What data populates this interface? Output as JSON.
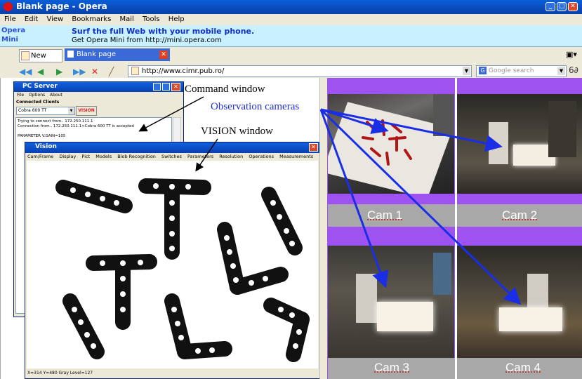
{
  "browser": {
    "title": "Blank page - Opera",
    "menu": [
      "File",
      "Edit",
      "View",
      "Bookmarks",
      "Mail",
      "Tools",
      "Help"
    ],
    "banner": {
      "brand1": "Opera",
      "brand2": "Mini",
      "line1": "Surf the full Web with your mobile phone.",
      "line2": "Get Opera Mini from http://mini.opera.com"
    },
    "tabs": {
      "new_page": "New page",
      "active": "Blank page"
    },
    "address": "http://www.cimr.pub.ro/",
    "search_placeholder": "Google search"
  },
  "pc_server": {
    "title": "PC Server",
    "menu": [
      "File",
      "Options",
      "About"
    ],
    "connected_clients": "Connected Clients",
    "client": "Cobra 600 TT",
    "vision_btn": "VISION",
    "log": [
      "Trying to connect from.. 172.250.111.1",
      "Connection from.. 172.250.111.1<Cobra 600 TT is accepted",
      "",
      "PARAMETER V.GAIN=105"
    ]
  },
  "vision": {
    "title": "Vision",
    "menu": [
      "Cam/Frame",
      "Display",
      "Pict",
      "Models",
      "Blob Recognition",
      "Switches",
      "Parameters",
      "Resolution",
      "Operations",
      "Measurements"
    ],
    "status": "X=314 Y=480 Gray Level=127"
  },
  "annotations": {
    "command": "Command window",
    "observation": "Observation cameras",
    "vision": "VISION window"
  },
  "cameras": [
    "Cam 1",
    "Cam 2",
    "Cam 3",
    "Cam 4"
  ],
  "colors": {
    "xp_blue": "#0a246a",
    "cam_purple": "#9e53f0",
    "arrow": "#1a2ee6",
    "annotation_blue": "#1f2fd8",
    "label_grey": "#a8a8a8"
  }
}
